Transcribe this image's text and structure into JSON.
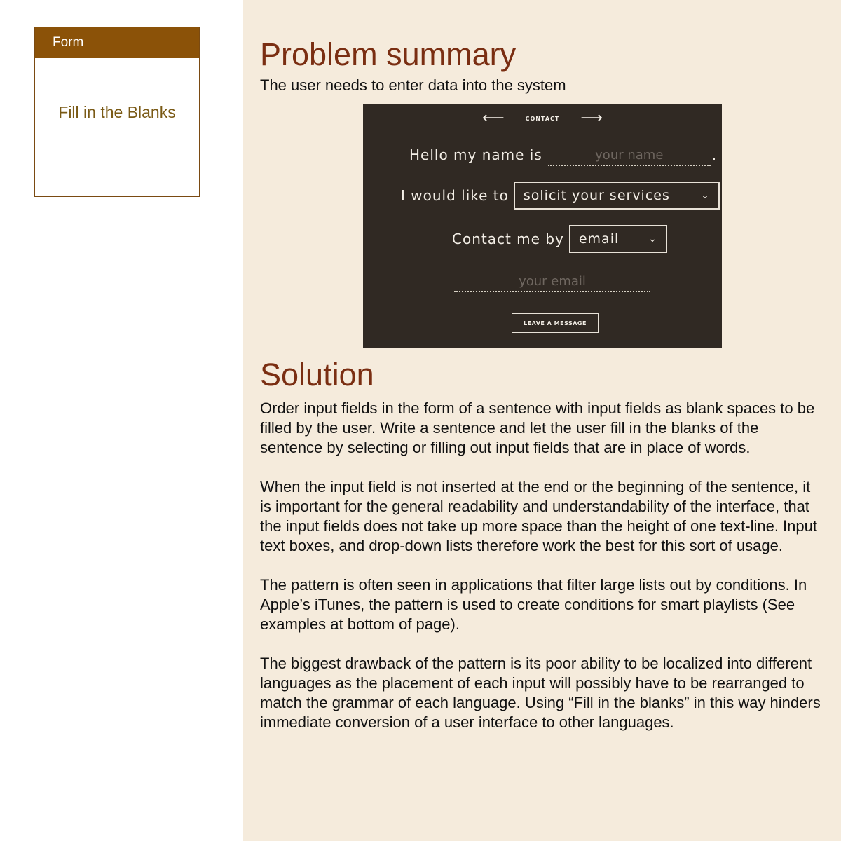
{
  "sidebar": {
    "card_header": "Form",
    "card_title": "Fill in the Blanks"
  },
  "problem": {
    "heading": "Problem summary",
    "text": "The user needs to enter data into the system"
  },
  "example_form": {
    "nav_label": "CONTACT",
    "prev_arrow": "⟵",
    "next_arrow": "⟶",
    "name_label": "Hello my name is",
    "name_placeholder": "your name",
    "name_period": ".",
    "intent_label": "I would like to",
    "intent_value": "solicit your services",
    "contact_label": "Contact me by",
    "contact_value": "email",
    "email_placeholder": "your email",
    "button_label": "LEAVE A MESSAGE"
  },
  "solution": {
    "heading": "Solution",
    "paragraphs": [
      "Order input fields in the form of a sentence with input fields as blank spaces to be filled by the user. Write a sentence and let the user fill in the blanks of the sentence by selecting or filling out input fields that are in place of words.",
      "When the input field is not inserted at the end or the beginning of the sentence, it is important for the general readability and understandability of the interface, that the input fields does not take up more space than the height of one text-line. Input text boxes, and drop-down lists therefore work the best for this sort of usage.",
      "The pattern is often seen in applications that filter large lists out by conditions. In Apple’s iTunes, the pattern is used to create conditions for smart playlists (See examples at bottom of page).",
      "The biggest drawback of the pattern is its poor ability to be localized into different languages as the placement of each input will possibly have to be rearranged to match the grammar of each language. Using “Fill in the blanks” in this way hinders immediate conversion of a user interface to other languages."
    ]
  },
  "colors": {
    "accent": "#8b5208",
    "heading": "#7a2e12",
    "panel_bg": "#f5ebdc",
    "example_bg": "#302923"
  }
}
